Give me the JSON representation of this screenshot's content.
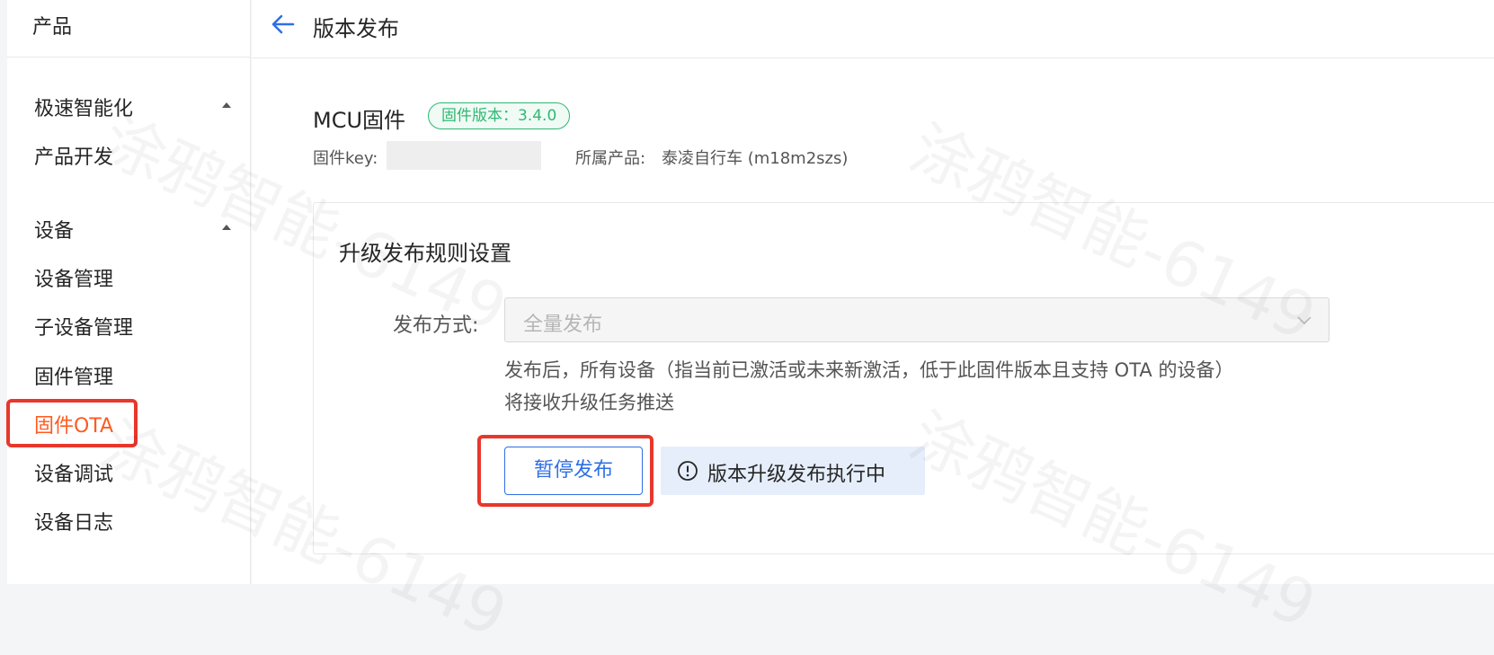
{
  "sidebar": {
    "top_label": "产品",
    "groups": [
      {
        "title": "极速智能化",
        "items": [
          "产品开发"
        ]
      },
      {
        "title": "设备",
        "items": [
          "设备管理",
          "子设备管理",
          "固件管理",
          "固件OTA",
          "设备调试",
          "设备日志"
        ]
      }
    ],
    "active_item": "固件OTA"
  },
  "header": {
    "title": "版本发布"
  },
  "firmware": {
    "name": "MCU固件",
    "version_tag": "固件版本：3.4.0",
    "key_label": "固件key:",
    "product_label": "所属产品:",
    "product_value": "泰凌自行车 (m18m2szs)"
  },
  "card": {
    "title": "升级发布规则设置",
    "release_method_label": "发布方式:",
    "release_method_value": "全量发布",
    "description_line1": "发布后，所有设备（指当前已激活或未来新激活，低于此固件版本且支持 OTA 的设备）",
    "description_line2": "将接收升级任务推送",
    "pause_button": "暂停发布",
    "status_text": "版本升级发布执行中"
  },
  "watermark": "涂鸦智能-6149",
  "colors": {
    "accent_blue": "#2f6fe4",
    "active_orange": "#ff5a1f",
    "tag_green": "#2eb872",
    "highlight_red": "#e8372c"
  }
}
